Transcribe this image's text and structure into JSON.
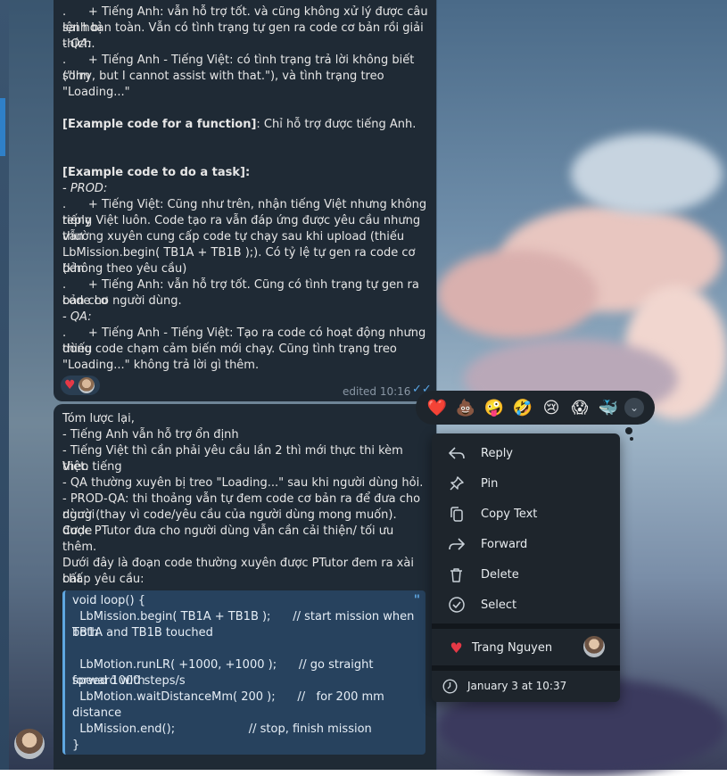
{
  "message1": {
    "lines": [
      {
        "text": ".      + Tiếng Anh: vẫn hỗ trợ tốt. và cũng không xử lý được câu lệnh bị",
        "style": ""
      },
      {
        "text": "sai hoàn toàn. Vẫn có tình trạng tự gen ra code cơ bản rồi giải thích.",
        "style": ""
      },
      {
        "text": "- QA:",
        "style": "i"
      },
      {
        "text": ".      + Tiếng Anh - Tiếng Việt: có tình trạng trả lời không biết (\"I'm",
        "style": ""
      },
      {
        "text": "sorry, but I cannot assist with that.\"), và tình trạng treo \"Loading...\"",
        "style": ""
      },
      {
        "text": "",
        "style": ""
      },
      {
        "text": "",
        "style": ""
      },
      {
        "text": "[Example code for a function]: Chỉ hỗ trợ được tiếng Anh.",
        "style": "mixed1"
      },
      {
        "text": "",
        "style": ""
      },
      {
        "text": "",
        "style": ""
      },
      {
        "text": "[Example code to do a task]:",
        "style": "b"
      },
      {
        "text": "- PROD:",
        "style": "i"
      },
      {
        "text": ".      + Tiếng Việt: Cũng như trên, nhận tiếng Việt nhưng không reply",
        "style": ""
      },
      {
        "text": "tiếng Việt luôn. Code tạo ra vẫn đáp ứng được yêu cầu nhưng vẫn",
        "style": ""
      },
      {
        "text": "thường xuyên cung cấp code tự chạy sau khi upload (thiếu",
        "style": ""
      },
      {
        "text": "LbMission.begin( TB1A + TB1B );). Có tỷ lệ tự gen ra code cơ bản",
        "style": ""
      },
      {
        "text": "(không theo yêu cầu)",
        "style": ""
      },
      {
        "text": ".      + Tiếng Anh: vẫn hỗ trợ tốt. Cũng có tình trạng tự gen ra code cơ",
        "style": ""
      },
      {
        "text": "bản cho người dùng.",
        "style": ""
      },
      {
        "text": "- QA:",
        "style": "i"
      },
      {
        "text": ".      + Tiếng Anh - Tiếng Việt: Tạo ra code có hoạt động nhưng thiếu",
        "style": ""
      },
      {
        "text": "dòng code chạm cảm biến mới chạy. Cũng tình trạng treo",
        "style": ""
      },
      {
        "text": "\"Loading...\" không trả lời gì thêm.",
        "style": ""
      }
    ],
    "bold_prefix": "[Example code for a function]",
    "rest_after_bold": ": Chỉ hỗ trợ được tiếng Anh.",
    "edited_label": "edited 10:16",
    "check_icon": "double-check-icon"
  },
  "message2": {
    "lines": [
      "Tóm lược lại,",
      "- Tiếng Anh vẫn hỗ trợ ổn định",
      "- Tiếng Việt thì cần phải yêu cầu lần 2 thì mới thực thi kèm theo tiếng",
      "Việt.",
      "- QA thường xuyên bị treo \"Loading...\" sau khi người dùng hỏi.",
      "- PROD-QA: thi thoảng vẫn tự đem code cơ bản ra để đưa cho người",
      "dùng (thay vì code/yêu cầu của người dùng mong muốn). Code",
      "được PTutor đưa cho người dùng vẫn cần cải thiện/ tối ưu thêm.",
      "",
      "Dưới đây là đoạn code thường xuyên được PTutor đem ra xài bất",
      "chấp yêu cầu:"
    ],
    "code_lines": [
      "void loop() {",
      "  LbMission.begin( TB1A + TB1B );      // start mission when both",
      "TB1A and TB1B touched",
      "",
      "  LbMotion.runLR( +1000, +1000 );      // go straight forward with",
      "speed 1000 steps/s",
      "  LbMotion.waitDistanceMm( 200 );      //   for 200 mm distance",
      "",
      "  LbMission.end();                    // stop, finish mission",
      "}"
    ]
  },
  "reactions_bar": {
    "emojis": [
      "❤️",
      "💩",
      "🤪",
      "🤣",
      "😢",
      "😱",
      "🐳"
    ],
    "expand_icon": "chevron-down-icon"
  },
  "context_menu": {
    "items": [
      {
        "label": "Reply",
        "icon": "reply-icon"
      },
      {
        "label": "Pin",
        "icon": "pin-icon"
      },
      {
        "label": "Copy Text",
        "icon": "copy-icon"
      },
      {
        "label": "Forward",
        "icon": "forward-icon"
      },
      {
        "label": "Delete",
        "icon": "trash-icon"
      },
      {
        "label": "Select",
        "icon": "check-circle-icon"
      }
    ],
    "reactor_name": "Trang Nguyen",
    "reactor_emoji": "❤️",
    "timestamp": "January 3 at 10:37"
  },
  "colors": {
    "bubble": "#1f2a35",
    "accent": "#5fa6e0",
    "menu": "#1e252c",
    "heart": "#e53946"
  }
}
